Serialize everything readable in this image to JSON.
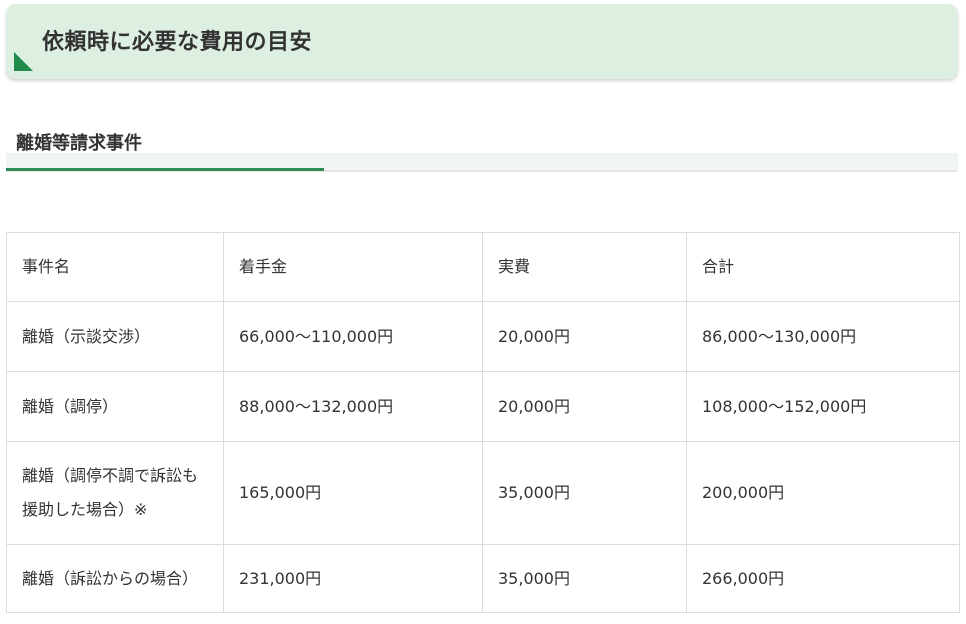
{
  "section": {
    "title": "依頼時に必要な費用の目安"
  },
  "subsection": {
    "title": "離婚等請求事件"
  },
  "table": {
    "headers": [
      "事件名",
      "着手金",
      "実費",
      "合計"
    ],
    "rows": [
      [
        "離婚（示談交渉）",
        "66,000～110,000円",
        "20,000円",
        "86,000～130,000円"
      ],
      [
        "離婚（調停）",
        "88,000～132,000円",
        "20,000円",
        "108,000～152,000円"
      ],
      [
        "離婚（調停不調で訴訟も援助した場合）※",
        "165,000円",
        "35,000円",
        "200,000円"
      ],
      [
        "離婚（訴訟からの場合）",
        "231,000円",
        "35,000円",
        "266,000円"
      ]
    ]
  },
  "colors": {
    "header_bg": "#dcefe0",
    "accent_green": "#2e8b57",
    "corner_green": "#1f8a4c",
    "text": "#333333",
    "border": "#dcdcdc"
  }
}
